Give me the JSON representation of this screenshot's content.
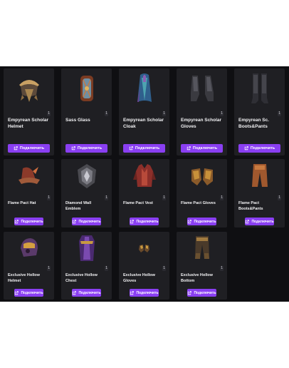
{
  "accent_color": "#8a3ff2",
  "button_icon": "external-link-icon",
  "items": [
    {
      "name": "Empyrean Scholar Helmet",
      "count": "1",
      "button": "Подключить",
      "icon": "helmet-icon"
    },
    {
      "name": "Sass Glass",
      "count": "1",
      "button": "Подключить",
      "icon": "glass-icon"
    },
    {
      "name": "Empyrean Scholar Cloak",
      "count": "1",
      "button": "Подключить",
      "icon": "cloak-icon"
    },
    {
      "name": "Empyrean Scholar Gloves",
      "count": "1",
      "button": "Подключить",
      "icon": "gloves-icon"
    },
    {
      "name": "Empyrean Sc. Boots&Pants",
      "count": "1",
      "button": "Подключить",
      "icon": "boots-icon"
    },
    {
      "name": "Flame Pact Hat",
      "count": "1",
      "button": "Подключить",
      "icon": "hat-icon"
    },
    {
      "name": "Diamond Wall Emblem",
      "count": "1",
      "button": "Подключить",
      "icon": "emblem-icon"
    },
    {
      "name": "Flame Pact Vest",
      "count": "1",
      "button": "Подключить",
      "icon": "vest-icon"
    },
    {
      "name": "Flame Pact Gloves",
      "count": "1",
      "button": "Подключить",
      "icon": "gloves-icon"
    },
    {
      "name": "Flame Pact Boots&Pants",
      "count": "1",
      "button": "Подключить",
      "icon": "pants-icon"
    },
    {
      "name": "Exclusive Hollow Helmet",
      "count": "1",
      "button": "Подключить",
      "icon": "helmet-icon"
    },
    {
      "name": "Exclusive Hollow Chest",
      "count": "1",
      "button": "Подключить",
      "icon": "chest-armor-icon"
    },
    {
      "name": "Exclusive Hollow Gloves",
      "count": "1",
      "button": "Подключить",
      "icon": "gloves-icon"
    },
    {
      "name": "Exclusive Hollow Bottom",
      "count": "1",
      "button": "Подключить",
      "icon": "pants-icon"
    }
  ]
}
